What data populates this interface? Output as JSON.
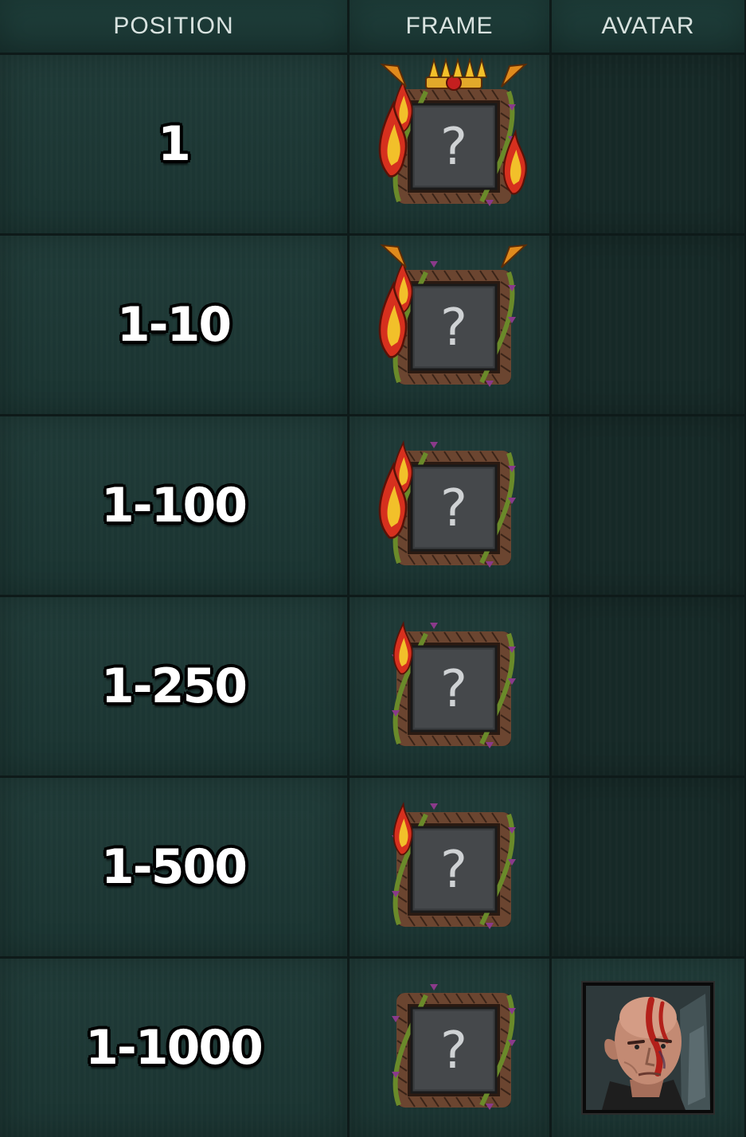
{
  "headers": {
    "position": "POSITION",
    "frame": "FRAME",
    "avatar": "AVATAR"
  },
  "rows": [
    {
      "position": "1",
      "frame_icon": "frame-legendary-icon",
      "placeholder": "?"
    },
    {
      "position": "1-10",
      "frame_icon": "frame-epic-icon",
      "placeholder": "?"
    },
    {
      "position": "1-100",
      "frame_icon": "frame-rare-icon",
      "placeholder": "?"
    },
    {
      "position": "1-250",
      "frame_icon": "frame-uncommon-icon",
      "placeholder": "?"
    },
    {
      "position": "1-500",
      "frame_icon": "frame-common-icon",
      "placeholder": "?"
    },
    {
      "position": "1-1000",
      "frame_icon": "frame-basic-icon",
      "placeholder": "?",
      "avatar_icon": "warrior-portrait-icon"
    }
  ],
  "colors": {
    "cell_bg": "#1d3936",
    "cell_dark_bg": "#172a28",
    "header_text": "#d8e2df",
    "vine_brown": "#6b4530",
    "vine_green": "#6a8a2a",
    "flame_red": "#d6301e",
    "flame_yellow": "#f2c02a"
  }
}
